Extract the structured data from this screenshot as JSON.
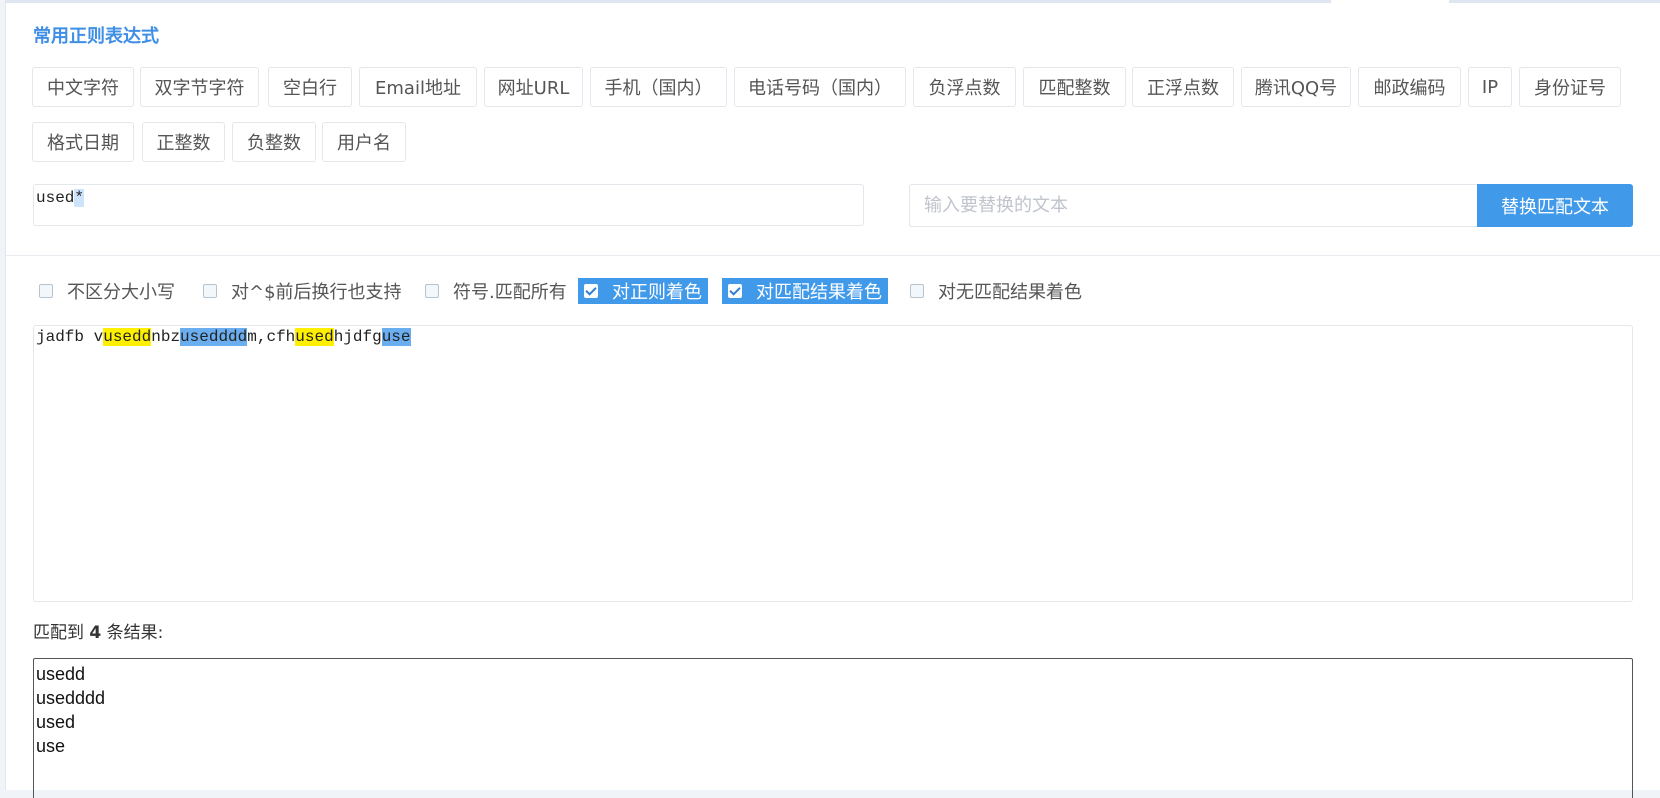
{
  "section": {
    "title": "常用正则表达式"
  },
  "presets": [
    "中文字符",
    "双字节字符",
    "空白行",
    "Email地址",
    "网址URL",
    "手机（国内）",
    "电话号码（国内）",
    "负浮点数",
    "匹配整数",
    "正浮点数",
    "腾讯QQ号",
    "邮政编码",
    "IP",
    "身份证号",
    "格式日期",
    "正整数",
    "负整数",
    "用户名"
  ],
  "regex": {
    "text": "used",
    "selected": "*"
  },
  "replace": {
    "placeholder": "输入要替换的文本",
    "button_label": "替换匹配文本"
  },
  "options": [
    {
      "label": "不区分大小写",
      "checked": false
    },
    {
      "label": "对^$前后换行也支持",
      "checked": false
    },
    {
      "label": "符号.匹配所有",
      "checked": false
    },
    {
      "label": "对正则着色",
      "checked": true
    },
    {
      "label": "对匹配结果着色",
      "checked": true
    },
    {
      "label": "对无匹配结果着色",
      "checked": false
    }
  ],
  "test_text": {
    "segments": [
      {
        "text": "jadfb v",
        "hl": ""
      },
      {
        "text": "usedd",
        "hl": "yellow"
      },
      {
        "text": "nbz",
        "hl": ""
      },
      {
        "text": "usedddd",
        "hl": "blue"
      },
      {
        "text": "m,cfh",
        "hl": ""
      },
      {
        "text": "used",
        "hl": "yellow"
      },
      {
        "text": "hjdfg",
        "hl": ""
      },
      {
        "text": "use",
        "hl": "blue"
      }
    ]
  },
  "result": {
    "prefix": "匹配到",
    "count": "4",
    "suffix": "条结果:",
    "matches": [
      "usedd",
      "usedddd",
      "used",
      "use"
    ]
  },
  "colors": {
    "accent": "#4199ea",
    "title": "#3f8fe6",
    "highlight_yellow": "#ffef00",
    "highlight_blue": "#6aaef0"
  }
}
